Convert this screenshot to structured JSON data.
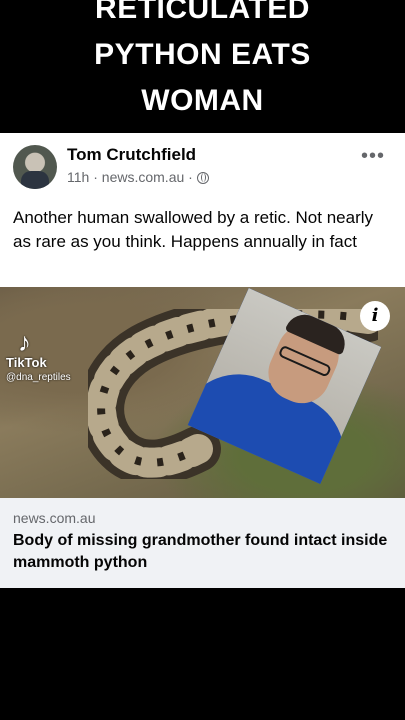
{
  "headline": {
    "line1": "RETICULATED",
    "line2": "PYTHON EATS",
    "line3": "WOMAN"
  },
  "post": {
    "author": "Tom Crutchfield",
    "time": "11h",
    "source": "news.com.au",
    "separator": "·",
    "body_text": "Another human swallowed by a retic. Not nearly as rare as you think. Happens annually in fact",
    "more_label": "•••"
  },
  "photo": {
    "info_label": "i",
    "watermark_brand": "TikTok",
    "watermark_handle": "@dna_reptiles"
  },
  "link": {
    "domain": "news.com.au",
    "title": "Body of missing grandmother found intact inside mammoth python"
  }
}
